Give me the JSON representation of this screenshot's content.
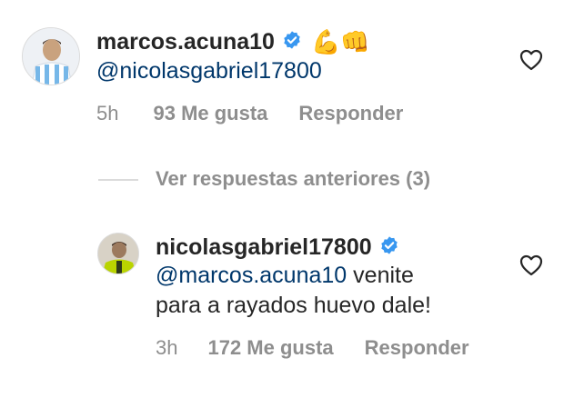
{
  "comments": [
    {
      "username": "marcos.acuna10",
      "emojis": "💪👊",
      "mention": "@nicolasgabriel17800",
      "text_rest": "",
      "time": "5h",
      "likes": "93 Me gusta",
      "reply_label": "Responder"
    },
    {
      "username": "nicolasgabriel17800",
      "mention": "@marcos.acuna10",
      "text_rest": " venite",
      "text_line2": "para a rayados huevo dale!",
      "time": "3h",
      "likes": "172 Me gusta",
      "reply_label": "Responder"
    }
  ],
  "view_previous_replies": "Ver respuestas anteriores (3)",
  "colors": {
    "verified": "#3897f0",
    "mention": "#00376b",
    "meta": "#8e8e8e"
  },
  "icons": {
    "verified": "verified-badge-icon",
    "like": "heart-outline-icon"
  }
}
